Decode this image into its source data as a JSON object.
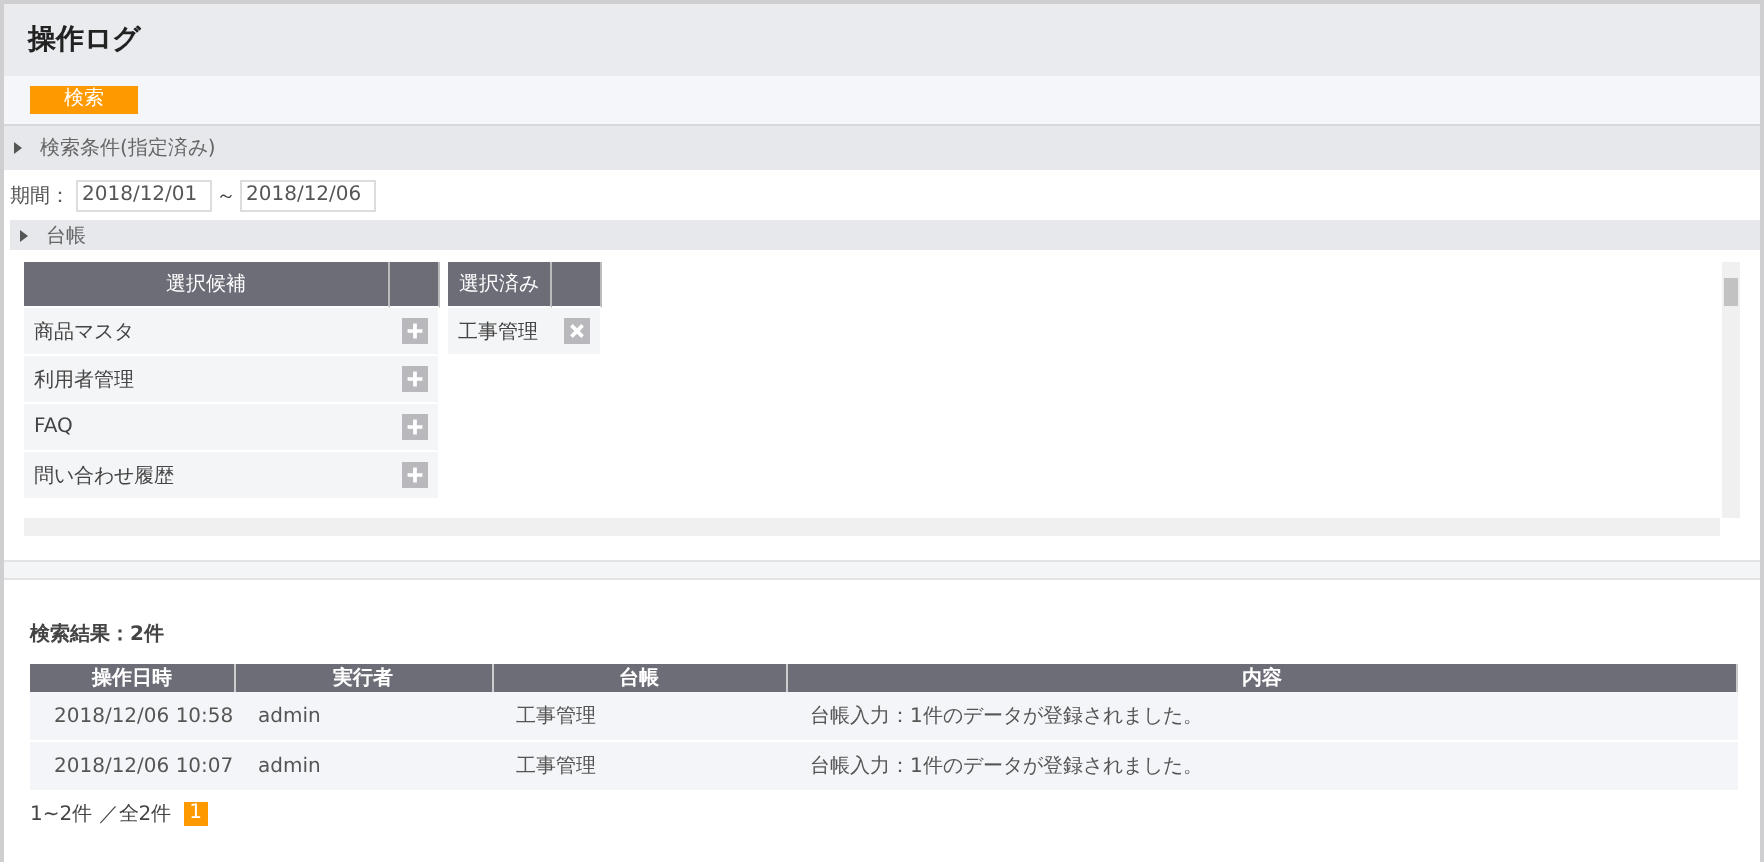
{
  "page_title": "操作ログ",
  "search_button": "検索",
  "conditions": {
    "title": "検索条件(指定済み)",
    "expanded": true
  },
  "period": {
    "label": "期間：",
    "from": "2018/12/01",
    "separator": "～",
    "to": "2018/12/06"
  },
  "ledger": {
    "title": "台帳",
    "candidates": {
      "header": "選択候補",
      "items": [
        "商品マスタ",
        "利用者管理",
        "FAQ",
        "問い合わせ履歴"
      ]
    },
    "selected": {
      "header": "選択済み",
      "items": [
        "工事管理"
      ]
    }
  },
  "results": {
    "title": "検索結果：2件",
    "columns": [
      "操作日時",
      "実行者",
      "台帳",
      "内容"
    ],
    "rows": [
      {
        "cells": [
          "2018/12/06 10:58",
          "admin",
          "工事管理",
          "台帳入力：1件のデータが登録されました。"
        ]
      },
      {
        "cells": [
          "2018/12/06 10:07",
          "admin",
          "工事管理",
          "台帳入力：1件のデータが登録されました。"
        ]
      }
    ],
    "summary": "1~2件 ／全2件",
    "pages": [
      {
        "label": "1",
        "selected": true
      }
    ]
  }
}
